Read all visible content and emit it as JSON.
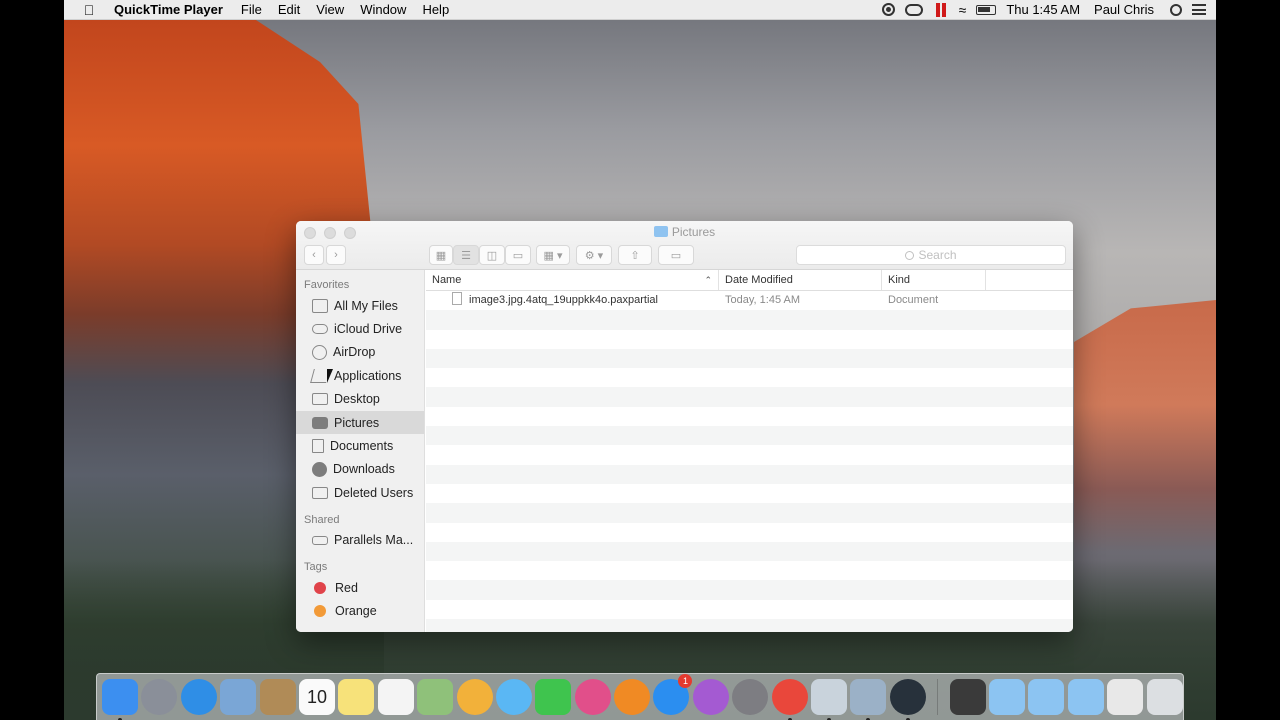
{
  "menubar": {
    "apple": "",
    "app_name": "QuickTime Player",
    "menus": [
      "File",
      "Edit",
      "View",
      "Window",
      "Help"
    ],
    "clock": "Thu 1:45 AM",
    "user": "Paul Chris",
    "status_icons": [
      "record-icon",
      "creative-cloud-icon",
      "parallels-pause-icon",
      "wifi-icon",
      "battery-icon",
      "spotlight-icon",
      "notification-center-icon"
    ]
  },
  "finder": {
    "title": "Pictures",
    "search_placeholder": "Search",
    "sidebar": {
      "favorites_heading": "Favorites",
      "favorites": [
        {
          "label": "All My Files",
          "icon": "all-files-icon"
        },
        {
          "label": "iCloud Drive",
          "icon": "cloud-icon"
        },
        {
          "label": "AirDrop",
          "icon": "airdrop-icon"
        },
        {
          "label": "Applications",
          "icon": "applications-icon"
        },
        {
          "label": "Desktop",
          "icon": "desktop-icon"
        },
        {
          "label": "Pictures",
          "icon": "camera-icon",
          "selected": true
        },
        {
          "label": "Documents",
          "icon": "document-icon"
        },
        {
          "label": "Downloads",
          "icon": "download-icon"
        },
        {
          "label": "Deleted Users",
          "icon": "folder-icon"
        }
      ],
      "shared_heading": "Shared",
      "shared": [
        {
          "label": "Parallels Ma...",
          "icon": "drive-icon"
        }
      ],
      "tags_heading": "Tags",
      "tags": [
        {
          "label": "Red",
          "color": "#e0434a"
        },
        {
          "label": "Orange",
          "color": "#f29a38"
        }
      ]
    },
    "columns": {
      "name": "Name",
      "date": "Date Modified",
      "kind": "Kind"
    },
    "files": [
      {
        "name": "image3.jpg.4atq_19uppkk4o.paxpartial",
        "date": "Today, 1:45 AM",
        "kind": "Document"
      }
    ]
  },
  "dock": {
    "apps": [
      {
        "name": "finder-icon",
        "color": "#3c8ff0",
        "running": true
      },
      {
        "name": "launchpad-icon",
        "color": "#8a8f99"
      },
      {
        "name": "safari-icon",
        "color": "#2f8ee6"
      },
      {
        "name": "mail-icon",
        "color": "#7aa6d6"
      },
      {
        "name": "contacts-icon",
        "color": "#b08b57"
      },
      {
        "name": "calendar-icon",
        "color": "#fafafa",
        "label": "10"
      },
      {
        "name": "notes-icon",
        "color": "#f7e27a"
      },
      {
        "name": "reminders-icon",
        "color": "#f4f4f4"
      },
      {
        "name": "maps-icon",
        "color": "#8fc17a"
      },
      {
        "name": "photos-icon",
        "color": "#f2b13a"
      },
      {
        "name": "messages-icon",
        "color": "#5ab7f4"
      },
      {
        "name": "facetime-icon",
        "color": "#3fc44e"
      },
      {
        "name": "itunes-icon",
        "color": "#e14f8a"
      },
      {
        "name": "ibooks-icon",
        "color": "#f08a24"
      },
      {
        "name": "app-store-icon",
        "color": "#2b8ef0",
        "badge": "1"
      },
      {
        "name": "feedback-icon",
        "color": "#a45ad2"
      },
      {
        "name": "system-preferences-icon",
        "color": "#7d7d82"
      },
      {
        "name": "chrome-icon",
        "color": "#e9473b",
        "running": true
      },
      {
        "name": "parallels-icon",
        "color": "#c9d3dc",
        "running": true
      },
      {
        "name": "preview-icon",
        "color": "#9bb1c7",
        "running": true
      },
      {
        "name": "quicktime-icon",
        "color": "#27313b",
        "running": true
      }
    ],
    "others": [
      {
        "name": "screenshot-icon",
        "color": "#3a3a3a"
      },
      {
        "name": "folder-icon",
        "color": "#8cc4f2"
      },
      {
        "name": "folder-icon",
        "color": "#8cc4f2"
      },
      {
        "name": "folder-icon",
        "color": "#8cc4f2"
      },
      {
        "name": "window-icon",
        "color": "#e8e8e8"
      },
      {
        "name": "trash-icon",
        "color": "#dcdfe2"
      }
    ]
  }
}
